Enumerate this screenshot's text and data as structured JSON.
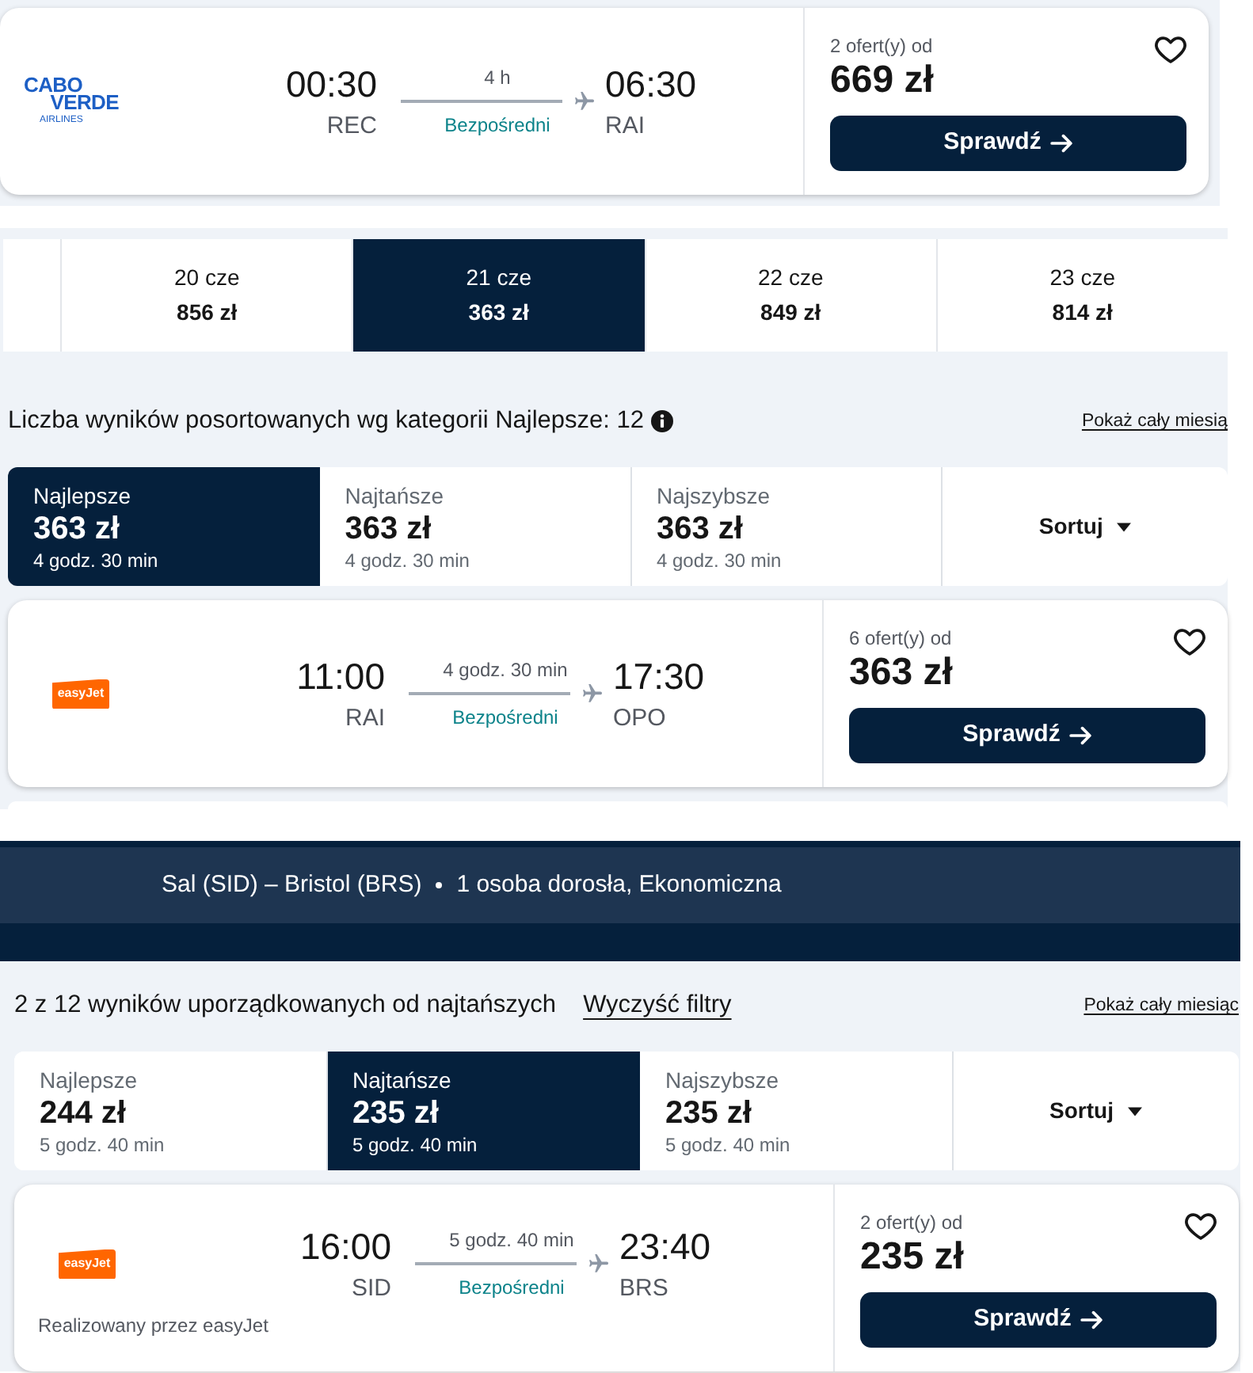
{
  "fragments": [
    {
      "parts": [
        {
          "kind": "flight_card",
          "airline_logo": {
            "kind": "wordmark",
            "lines": [
              "CABO",
              "VERDE",
              "AIRLINES"
            ]
          },
          "departure": {
            "time": "00:30",
            "airport": "REC"
          },
          "duration": "4 h",
          "stops": "Bezpośredni",
          "arrival": {
            "time": "06:30",
            "airport": "RAI"
          },
          "offers": "2 ofert(y) od",
          "price": "669 zł",
          "saved": false,
          "button": "Sprawdź"
        }
      ]
    },
    {
      "parts": [
        {
          "kind": "date_strip",
          "dates": [
            {
              "date": "20 cze",
              "price": "856 zł",
              "selected": false
            },
            {
              "date": "21 cze",
              "price": "363 zł",
              "selected": true
            },
            {
              "date": "22 cze",
              "price": "849 zł",
              "selected": false
            },
            {
              "date": "23 cze",
              "price": "814 zł",
              "selected": false
            }
          ]
        },
        {
          "kind": "results_header",
          "summary": "Liczba wyników posortowanych wg kategorii Najlepsze: 12",
          "info_icon": true,
          "month_link": "Pokaż cały miesią"
        },
        {
          "kind": "sort_tabs",
          "tabs": [
            {
              "label": "Najlepsze",
              "price": "363 zł",
              "duration": "4 godz. 30 min",
              "selected": true
            },
            {
              "label": "Najtańsze",
              "price": "363 zł",
              "duration": "4 godz. 30 min",
              "selected": false
            },
            {
              "label": "Najszybsze",
              "price": "363 zł",
              "duration": "4 godz. 30 min",
              "selected": false
            }
          ],
          "sort_button": "Sortuj"
        },
        {
          "kind": "flight_card",
          "airline_logo": {
            "kind": "tile",
            "lines": [
              "easyJet"
            ]
          },
          "departure": {
            "time": "11:00",
            "airport": "RAI"
          },
          "duration": "4 godz. 30 min",
          "stops": "Bezpośredni",
          "arrival": {
            "time": "17:30",
            "airport": "OPO"
          },
          "offers": "6 ofert(y) od",
          "price": "363 zł",
          "saved": false,
          "button": "Sprawdź"
        },
        {
          "kind": "partial_card"
        }
      ]
    },
    {
      "parts": [
        {
          "kind": "search_banner",
          "route": "Sal (SID) – Bristol (BRS)",
          "travellers": "1 osoba dorosła, Ekonomiczna"
        },
        {
          "kind": "results_header",
          "summary": "2 z 12 wyników uporządkowanych od najtańszych",
          "clear_filters": "Wyczyść filtry",
          "month_link": "Pokaż cały miesiąc"
        },
        {
          "kind": "sort_tabs",
          "tabs": [
            {
              "label": "Najlepsze",
              "price": "244 zł",
              "duration": "5 godz. 40 min",
              "selected": false
            },
            {
              "label": "Najtańsze",
              "price": "235 zł",
              "duration": "5 godz. 40 min",
              "selected": true
            },
            {
              "label": "Najszybsze",
              "price": "235 zł",
              "duration": "5 godz. 40 min",
              "selected": false
            }
          ],
          "sort_button": "Sortuj"
        },
        {
          "kind": "flight_card",
          "airline_logo": {
            "kind": "tile",
            "lines": [
              "easyJet"
            ]
          },
          "departure": {
            "time": "16:00",
            "airport": "SID"
          },
          "duration": "5 godz. 40 min",
          "stops": "Bezpośredni",
          "arrival": {
            "time": "23:40",
            "airport": "BRS"
          },
          "operated_by": "Realizowany przez easyJet",
          "offers": "2 ofert(y) od",
          "price": "235 zł",
          "saved": false,
          "button": "Sprawdź"
        }
      ]
    }
  ]
}
